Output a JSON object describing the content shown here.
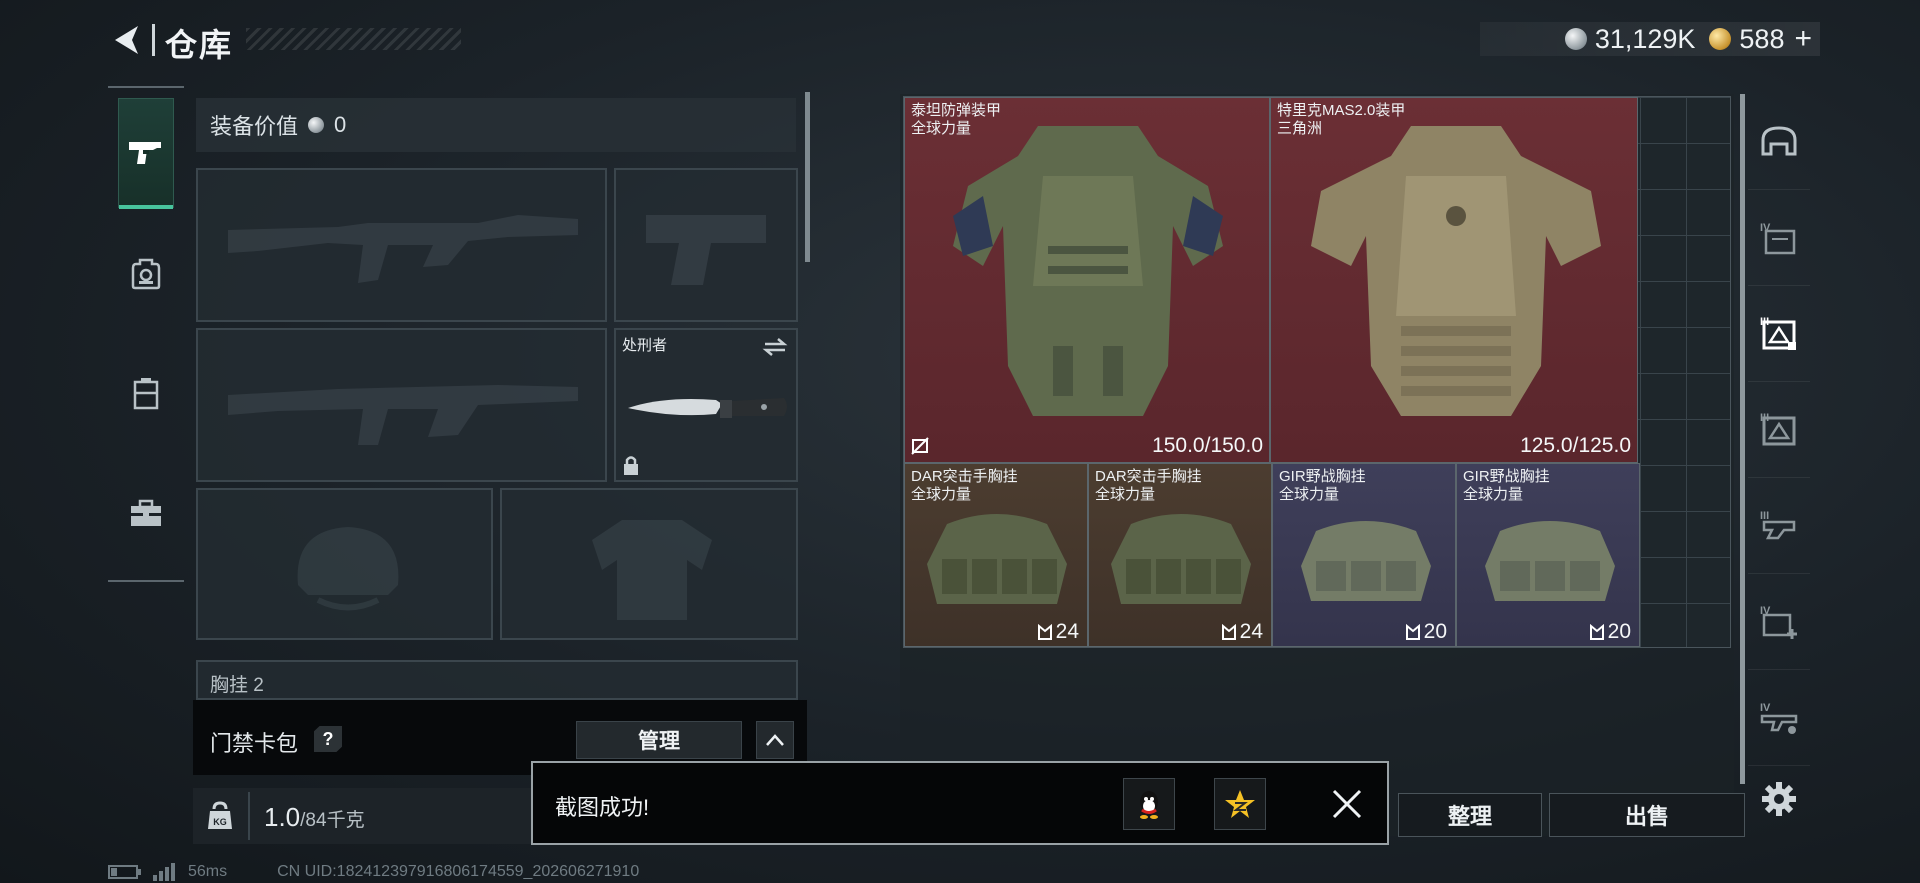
{
  "header": {
    "title": "仓库",
    "currencies": [
      {
        "icon": "silver-coin-icon",
        "value": "31,129K"
      },
      {
        "icon": "gold-coin-icon",
        "value": "588"
      }
    ],
    "plus": "+"
  },
  "left_tabs": [
    {
      "name": "pistol-icon",
      "active": true
    },
    {
      "name": "backpack-icon",
      "active": false
    },
    {
      "name": "locker-icon",
      "active": false
    },
    {
      "name": "toolbox-icon",
      "active": false
    }
  ],
  "loadout": {
    "equip_value_label": "装备价值",
    "equip_value": "0",
    "melee_name": "处刑者",
    "chest_rig_partial": "胸挂 2"
  },
  "access_card": {
    "title": "门禁卡包",
    "help": "?",
    "manage_label": "管理"
  },
  "weight": {
    "current": "1.0",
    "capacity": "/84千克"
  },
  "inventory": [
    {
      "name": "泰坦防弹装甲",
      "sub": "全球力量",
      "value": "150.0/150.0",
      "color": "red"
    },
    {
      "name": "特里克MAS2.0装甲",
      "sub": "三角洲",
      "value": "125.0/125.0",
      "color": "red"
    },
    {
      "name": "DAR突击手胸挂",
      "sub": "全球力量",
      "value": "24",
      "color": "brown"
    },
    {
      "name": "DAR突击手胸挂",
      "sub": "全球力量",
      "value": "24",
      "color": "brown"
    },
    {
      "name": "GIR野战胸挂",
      "sub": "全球力量",
      "value": "20",
      "color": "purple"
    },
    {
      "name": "GIR野战胸挂",
      "sub": "全球力量",
      "value": "20",
      "color": "purple"
    }
  ],
  "right_filters": [
    {
      "name": "filter-helmet-icon"
    },
    {
      "name": "filter-armor-iv-icon",
      "tier": "IV"
    },
    {
      "name": "filter-armor-iii-icon",
      "tier": "III",
      "active": true
    },
    {
      "name": "filter-armor-ii-icon",
      "tier": "III"
    },
    {
      "name": "filter-rig-icon",
      "tier": "III"
    },
    {
      "name": "filter-medical-iv-icon",
      "tier": "IV"
    },
    {
      "name": "filter-weapon-iv-icon",
      "tier": "IV"
    }
  ],
  "actions": {
    "sort_label": "整理",
    "sell_label": "出售"
  },
  "toast": {
    "message": "截图成功!"
  },
  "status": {
    "ping": "56ms",
    "uid": "CN UID:18241239791680617455​9_202606271910"
  },
  "colors": {
    "accent_green": "#48c49d",
    "item_red": "#6b2f35",
    "item_brown": "#4c3d30",
    "item_purple": "#3f3f5a"
  }
}
